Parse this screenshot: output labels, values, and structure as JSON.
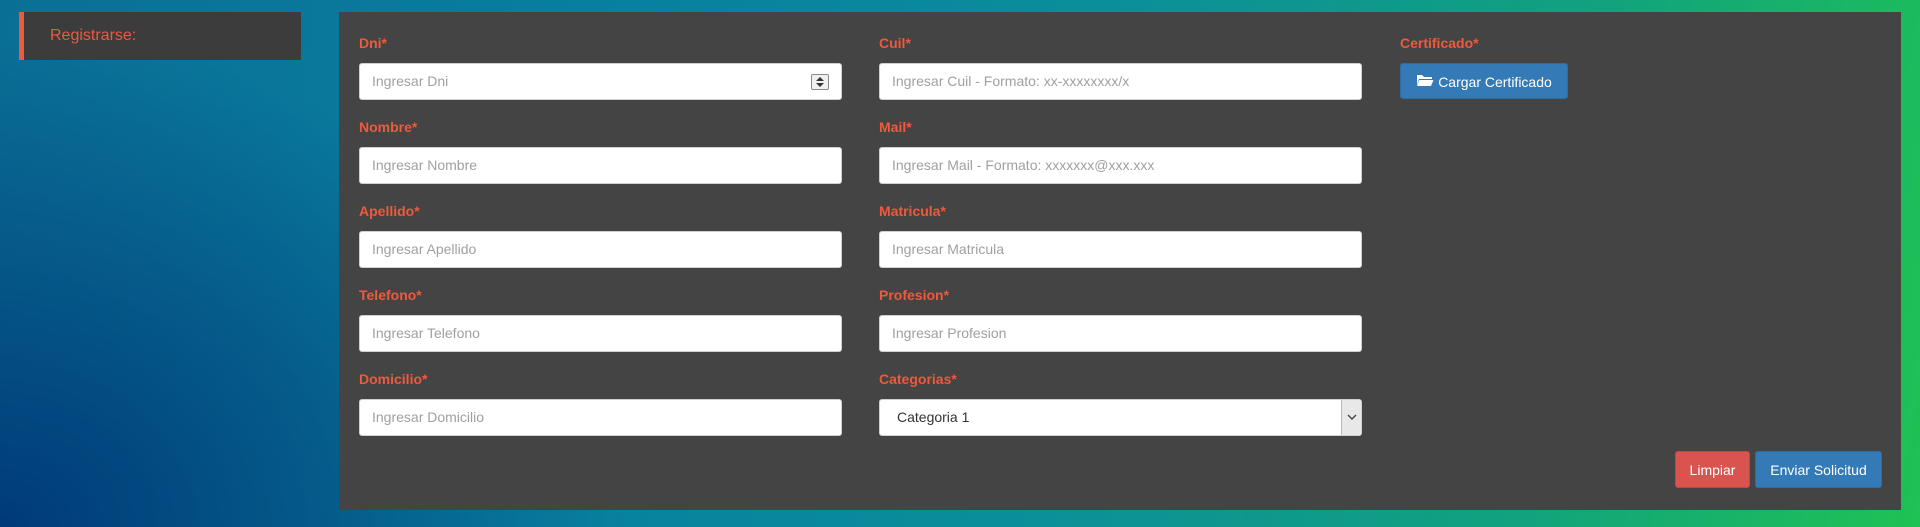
{
  "sidebar": {
    "register_label": "Registrarse:"
  },
  "form": {
    "fields": [
      {
        "label": "Dni*",
        "placeholder": "Ingresar Dni"
      },
      {
        "label": "Nombre*",
        "placeholder": "Ingresar Nombre"
      },
      {
        "label": "Apellido*",
        "placeholder": "Ingresar Apellido"
      },
      {
        "label": "Telefono*",
        "placeholder": "Ingresar Telefono"
      },
      {
        "label": "Domicilio*",
        "placeholder": "Ingresar Domicilio"
      },
      {
        "label": "Cuil*",
        "placeholder": "Ingresar Cuil - Formato: xx-xxxxxxxx/x"
      },
      {
        "label": "Mail*",
        "placeholder": "Ingresar Mail - Formato: xxxxxxx@xxx.xxx"
      },
      {
        "label": "Matricula*",
        "placeholder": "Ingresar Matricula"
      },
      {
        "label": "Profesion*",
        "placeholder": "Ingresar Profesion"
      },
      {
        "label": "Categorias*",
        "selected": "Categoria 1"
      }
    ],
    "certificate": {
      "label": "Certificado*",
      "button_label": "Cargar Certificado",
      "icon": "folder-open-icon"
    },
    "actions": {
      "clear_label": "Limpiar",
      "submit_label": "Enviar Solicitud"
    }
  },
  "colors": {
    "accent": "#ee5a3c",
    "panel": "#444444",
    "primary": "#337ab7",
    "danger": "#d9534f"
  }
}
